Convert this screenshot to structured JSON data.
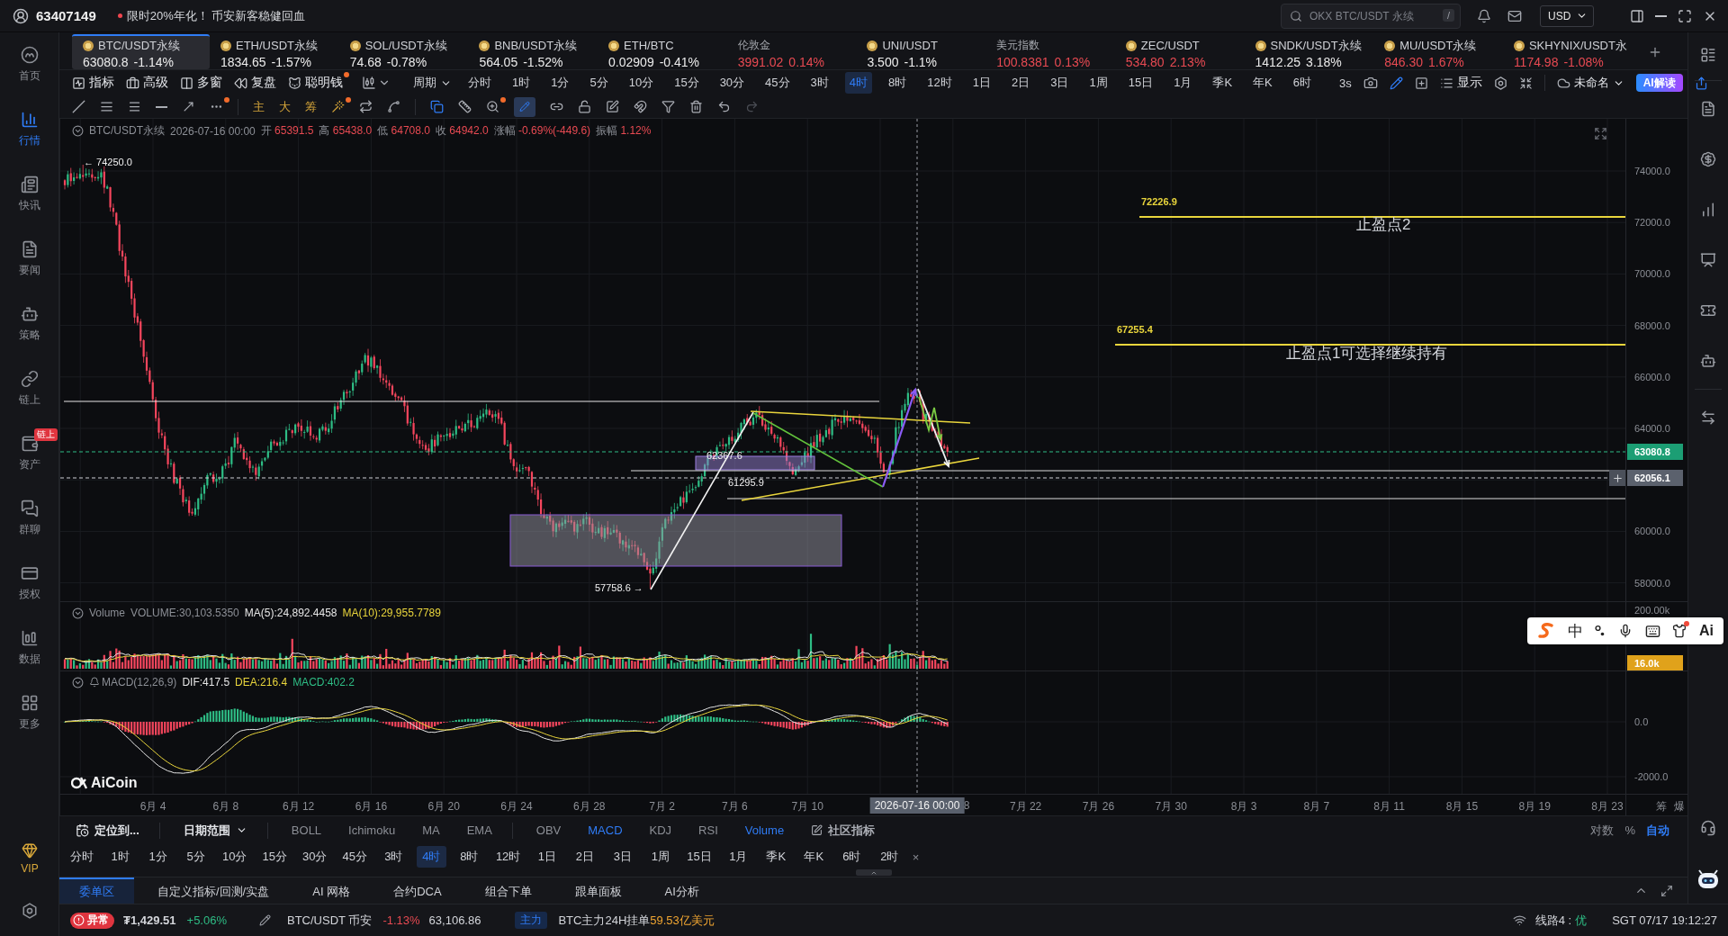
{
  "top_bar": {
    "user_id": "63407149",
    "promo": "限时20%年化！ 币安新客稳健回血",
    "search": {
      "placeholder": "OKX BTC/USDT 永续",
      "shortcut": "/"
    },
    "currency": "USD"
  },
  "sidebar": {
    "items": [
      {
        "label": "首页",
        "selected": false
      },
      {
        "label": "行情",
        "selected": true
      },
      {
        "label": "快讯",
        "selected": false
      },
      {
        "label": "要闻",
        "selected": false
      },
      {
        "label": "策略",
        "selected": false
      },
      {
        "label": "链上",
        "selected": false
      },
      {
        "label": "资产",
        "selected": false,
        "badge": "链上"
      },
      {
        "label": "群聊",
        "selected": false
      },
      {
        "label": "授权",
        "selected": false
      },
      {
        "label": "数据",
        "selected": false
      },
      {
        "label": "更多",
        "selected": false
      }
    ],
    "vip": "VIP"
  },
  "tickers": [
    {
      "kind": "coin",
      "name": "BTC/USDT永续",
      "price": "63080.8",
      "change": "-1.14%",
      "color": "#ececec",
      "selected": true
    },
    {
      "kind": "coin",
      "name": "ETH/USDT永续",
      "price": "1834.65",
      "change": "-1.57%",
      "color": "#ececec",
      "selected": false
    },
    {
      "kind": "coin",
      "name": "SOL/USDT永续",
      "price": "74.68",
      "change": "-0.78%",
      "color": "#ececec",
      "selected": false
    },
    {
      "kind": "coin",
      "name": "BNB/USDT永续",
      "price": "564.05",
      "change": "-1.52%",
      "color": "#ececec",
      "selected": false
    },
    {
      "kind": "coin",
      "name": "ETH/BTC",
      "price": "0.02909",
      "change": "-0.41%",
      "color": "#ececec",
      "selected": false
    },
    {
      "kind": "index",
      "name": "伦敦金",
      "price": "3991.02",
      "change": "0.14%",
      "color": "#e84a52",
      "selected": false
    },
    {
      "kind": "coin",
      "name": "UNI/USDT",
      "price": "3.500",
      "change": "-1.1%",
      "color": "#ececec",
      "selected": false
    },
    {
      "kind": "index",
      "name": "美元指数",
      "price": "100.8381",
      "change": "0.13%",
      "color": "#e84a52",
      "selected": false
    },
    {
      "kind": "coin",
      "name": "ZEC/USDT",
      "price": "534.80",
      "change": "2.13%",
      "color": "#e84a52",
      "selected": false
    },
    {
      "kind": "coin",
      "name": "SNDK/USDT永续",
      "price": "1412.25",
      "change": "3.18%",
      "color": "#ececec",
      "selected": false
    },
    {
      "kind": "coin",
      "name": "MU/USDT永续",
      "price": "846.30",
      "change": "1.67%",
      "color": "#e84a52",
      "selected": false
    },
    {
      "kind": "coin",
      "name": "SKHYNIX/USDT永",
      "price": "1174.98",
      "change": "-1.08%",
      "color": "#e84a52",
      "selected": false
    }
  ],
  "toolbar": {
    "tools": [
      {
        "label": "指标",
        "dot": false
      },
      {
        "label": "高级",
        "dot": false
      },
      {
        "label": "多窗",
        "dot": false
      },
      {
        "label": "复盘",
        "dot": false
      },
      {
        "label": "聪明钱",
        "dot": true
      }
    ],
    "period_menu": "周期",
    "periods": [
      {
        "label": "分时",
        "selected": false
      },
      {
        "label": "1时",
        "selected": false
      },
      {
        "label": "1分",
        "selected": false
      },
      {
        "label": "5分",
        "selected": false
      },
      {
        "label": "10分",
        "selected": false
      },
      {
        "label": "15分",
        "selected": false
      },
      {
        "label": "30分",
        "selected": false
      },
      {
        "label": "45分",
        "selected": false
      },
      {
        "label": "3时",
        "selected": false
      },
      {
        "label": "4时",
        "selected": true
      },
      {
        "label": "8时",
        "selected": false
      },
      {
        "label": "12时",
        "selected": false
      },
      {
        "label": "1日",
        "selected": false
      },
      {
        "label": "2日",
        "selected": false
      },
      {
        "label": "3日",
        "selected": false
      },
      {
        "label": "1周",
        "selected": false
      },
      {
        "label": "15日",
        "selected": false
      },
      {
        "label": "1月",
        "selected": false
      },
      {
        "label": "季K",
        "selected": false
      },
      {
        "label": "年K",
        "selected": false
      },
      {
        "label": "6时",
        "selected": false
      }
    ],
    "refresh": "3s",
    "display": "显示",
    "layout_name": "未命名",
    "ai_button": "AI解读"
  },
  "drawing_toolbar": {
    "marks": [
      "主",
      "大",
      "筹"
    ],
    "more_dot": true,
    "wand_dot": true,
    "zoom_dot": true,
    "pen_selected": true
  },
  "chart": {
    "legend": {
      "symbol": "BTC/USDT永续",
      "time": "2026-07-16 00:00",
      "fields": [
        {
          "label": "开",
          "value": "65391.5"
        },
        {
          "label": "高",
          "value": "65438.0"
        },
        {
          "label": "低",
          "value": "64708.0"
        },
        {
          "label": "收",
          "value": "64942.0"
        },
        {
          "label": "涨幅",
          "value": "-0.69%(-449.6)"
        },
        {
          "label": "振幅",
          "value": "1.12%"
        }
      ]
    },
    "price_ticks": [
      "74000.0",
      "72000.0",
      "70000.0",
      "68000.0",
      "66000.0",
      "64000.0",
      "60000.0",
      "58000.0"
    ],
    "price_tags": [
      {
        "kind": "last",
        "text": "63080.8"
      },
      {
        "kind": "cursor",
        "text": "62056.1"
      }
    ],
    "annotations": [
      {
        "kind": "price",
        "text": "← 74250.0"
      },
      {
        "kind": "price",
        "text": "62367.6"
      },
      {
        "kind": "price",
        "text": "61295.9"
      },
      {
        "kind": "price",
        "text": "57758.6 →"
      },
      {
        "kind": "level",
        "text": "72226.9"
      },
      {
        "kind": "note",
        "text": "止盈点2"
      },
      {
        "kind": "level",
        "text": "67255.4"
      },
      {
        "kind": "note",
        "text": "止盈点1可选择继续持有"
      }
    ],
    "brand": "AiCoin"
  },
  "volume": {
    "title": "Volume",
    "values": [
      {
        "kind": "total",
        "text": "VOLUME:30,103.5350"
      },
      {
        "kind": "fast",
        "text": "MA(5):24,892.4458"
      },
      {
        "kind": "slow",
        "text": "MA(10):29,955.7789"
      }
    ],
    "axis_ticks": [
      "200.00k"
    ],
    "last_tag": "16.0k"
  },
  "macd": {
    "title": "MACD(12,26,9)",
    "values": [
      {
        "kind": "fast",
        "text": "DIF:417.5"
      },
      {
        "kind": "slow",
        "text": "DEA:216.4"
      },
      {
        "kind": "hist",
        "text": "MACD:402.2"
      }
    ],
    "axis_ticks": [
      "0.0",
      "-2000.0"
    ]
  },
  "x_axis": {
    "labels": [
      "6月 4",
      "6月 8",
      "6月 12",
      "6月 16",
      "6月 20",
      "6月 24",
      "6月 28",
      "7月 2",
      "7月 6",
      "7月 10",
      "8",
      "7月 22",
      "7月 26",
      "7月 30",
      "8月 3",
      "8月 7",
      "8月 11",
      "8月 15",
      "8月 19",
      "8月 23"
    ],
    "cursor_label": "2026-07-16 00:00",
    "tools": [
      "筹",
      "爆"
    ]
  },
  "indicator_bar": {
    "locate": "定位到...",
    "date_range": "日期范围",
    "main_indicators": [
      {
        "label": "BOLL",
        "selected": false
      },
      {
        "label": "Ichimoku",
        "selected": false
      },
      {
        "label": "MA",
        "selected": false
      },
      {
        "label": "EMA",
        "selected": false
      }
    ],
    "sub_indicators": [
      {
        "label": "OBV",
        "selected": false
      },
      {
        "label": "MACD",
        "selected": true
      },
      {
        "label": "KDJ",
        "selected": false
      },
      {
        "label": "RSI",
        "selected": false
      },
      {
        "label": "Volume",
        "selected": true
      }
    ],
    "community": "社区指标",
    "scale_modes": [
      {
        "label": "对数",
        "selected": false
      },
      {
        "label": "%",
        "selected": false
      },
      {
        "label": "自动",
        "selected": true
      }
    ]
  },
  "quick_periods": {
    "items": [
      {
        "label": "分时",
        "selected": false
      },
      {
        "label": "1时",
        "selected": false
      },
      {
        "label": "1分",
        "selected": false
      },
      {
        "label": "5分",
        "selected": false
      },
      {
        "label": "10分",
        "selected": false
      },
      {
        "label": "15分",
        "selected": false
      },
      {
        "label": "30分",
        "selected": false
      },
      {
        "label": "45分",
        "selected": false
      },
      {
        "label": "3时",
        "selected": false
      },
      {
        "label": "4时",
        "selected": true
      },
      {
        "label": "8时",
        "selected": false
      },
      {
        "label": "12时",
        "selected": false
      },
      {
        "label": "1日",
        "selected": false
      },
      {
        "label": "2日",
        "selected": false
      },
      {
        "label": "3日",
        "selected": false
      },
      {
        "label": "1周",
        "selected": false
      },
      {
        "label": "15日",
        "selected": false
      },
      {
        "label": "1月",
        "selected": false
      },
      {
        "label": "季K",
        "selected": false
      },
      {
        "label": "年K",
        "selected": false
      },
      {
        "label": "6时",
        "selected": false
      },
      {
        "label": "2时",
        "selected": false
      }
    ],
    "close": "×"
  },
  "bottom_tabs": [
    {
      "label": "委单区",
      "selected": true
    },
    {
      "label": "自定义指标/回测/实盘",
      "selected": false
    },
    {
      "label": "AI 网格",
      "selected": false
    },
    {
      "label": "合约DCA",
      "selected": false
    },
    {
      "label": "组合下单",
      "selected": false
    },
    {
      "label": "跟单面板",
      "selected": false
    },
    {
      "label": "AI分析",
      "selected": false
    }
  ],
  "status_bar": {
    "alert": "异常",
    "balance": "₮1,429.51",
    "balance_change": "+5.06%",
    "pair": "BTC/USDT 币安",
    "pair_change": "-1.13%",
    "pair_price": "63,106.86",
    "tag": "主力",
    "info": "BTC主力24H挂单",
    "info_value": "59.53亿美元",
    "line": "线路4 :",
    "line_quality": "优",
    "clock": "SGT 07/17 19:12:27"
  },
  "ime_bar": {
    "mode": "中",
    "ai_label": "Ai",
    "skin_dot": true
  }
}
